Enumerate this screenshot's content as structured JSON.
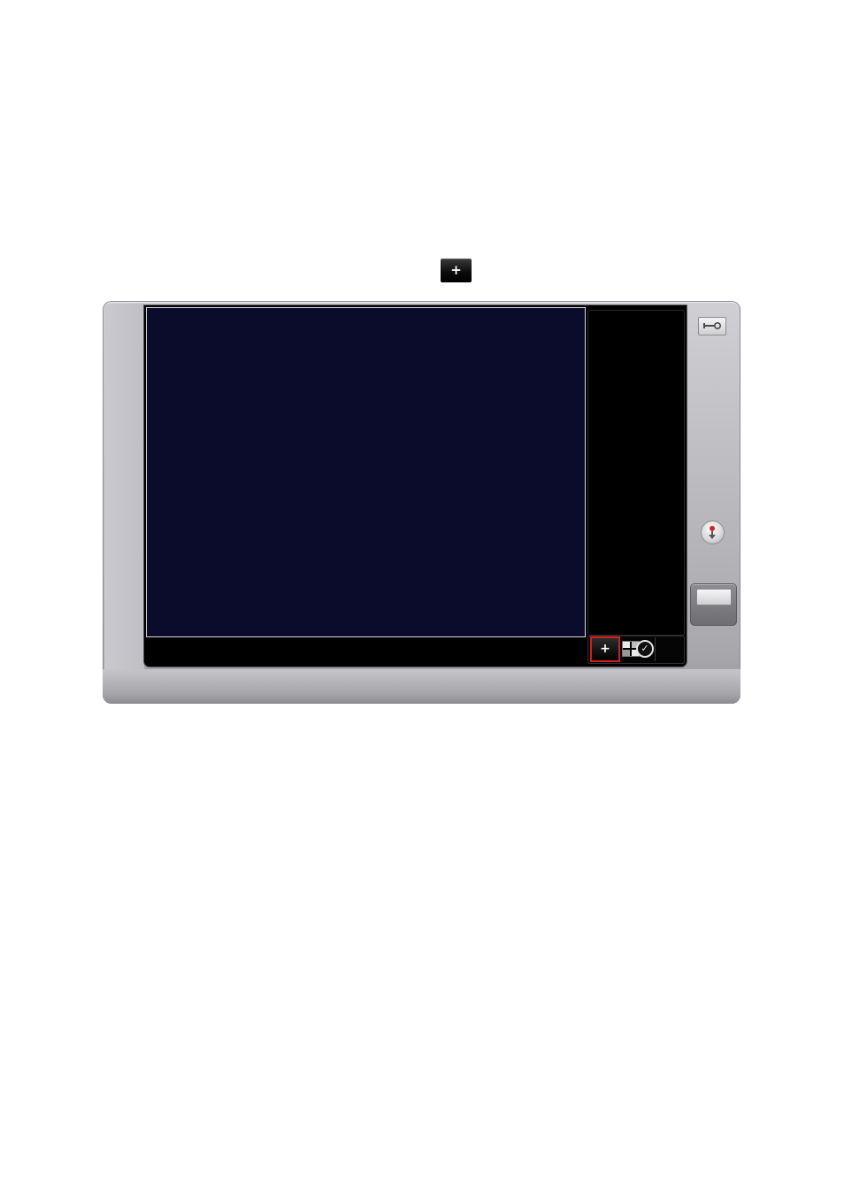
{
  "standalone_button": {
    "icon": "plus-icon",
    "label": "+"
  },
  "device": {
    "display": {
      "background": "#0b0c2c"
    },
    "toolbar": {
      "add_label": "+",
      "add_icon": "plus-icon",
      "add_highlight": "#d21e1e",
      "layout_icon": "grid-layout-icon",
      "schedule_icon": "clock-icon"
    },
    "right_rail": {
      "settings_icon": "wrench-icon",
      "record_icon": "record-download-icon",
      "side_button_icon": "blank-button-icon"
    }
  }
}
